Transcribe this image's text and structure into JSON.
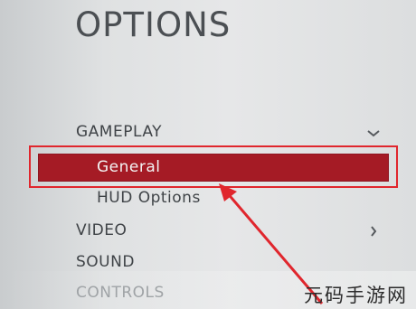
{
  "screen": {
    "title": "OPTIONS"
  },
  "menu": {
    "gameplay": {
      "label": "GAMEPLAY",
      "chevron": "chevron-down-icon",
      "expanded": true
    },
    "gameplay_items": [
      {
        "label": "General",
        "selected": true
      },
      {
        "label": "HUD Options",
        "selected": false
      }
    ],
    "video": {
      "label": "VIDEO",
      "chevron": "chevron-right-icon"
    },
    "sound": {
      "label": "SOUND"
    },
    "controls": {
      "label": "CONTROLS"
    }
  },
  "annotation": {
    "highlight_color": "#e0262d",
    "arrow_color": "#e0262d",
    "selected_row_color": "#a51b25"
  },
  "watermark": {
    "text": "元码手游网"
  }
}
